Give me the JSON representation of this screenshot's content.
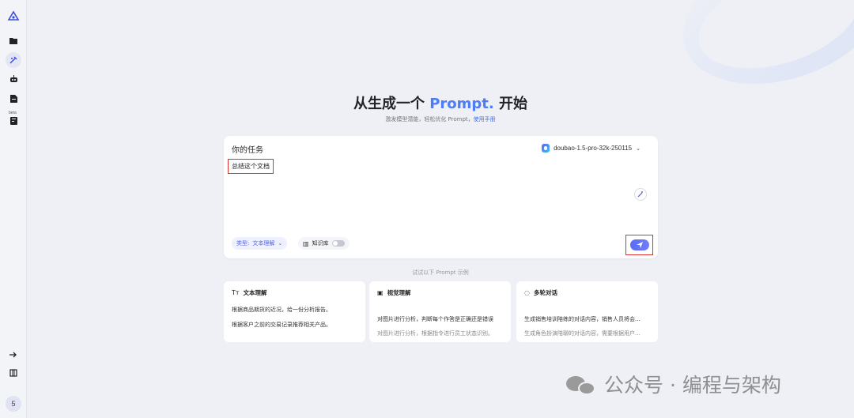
{
  "sidebar": {
    "icons": [
      "logo-icon",
      "folder-icon",
      "prompt-tool-icon",
      "robot-icon",
      "document-icon",
      "beta-feature-icon",
      "arrow-right-icon",
      "library-icon"
    ],
    "beta_label": "beta",
    "avatar_initial": "5"
  },
  "hero": {
    "title_pre": "从生成一个 ",
    "title_accent": "Prompt.",
    "title_post": " 开始",
    "subtitle": "激发模型潜能，轻松优化 Prompt，",
    "subtitle_link": "使用手册"
  },
  "task": {
    "label": "你的任务",
    "model": "doubao-1.5-pro-32k-250115",
    "prompt_text": "总结这个文档",
    "type_prefix": "类型:",
    "type_value": "文本理解",
    "kb_label": "知识库"
  },
  "examples": {
    "hint": "试试以下 Prompt 示例",
    "cards": [
      {
        "icon": "Tт",
        "title": "文本理解",
        "lines": [
          "根据商品期货的近况，给一份分析报告。",
          "根据客户之前的交易记录推荐相关产品。"
        ]
      },
      {
        "icon": "▣",
        "title": "视觉理解",
        "lines": [
          "对图片进行分析，判断每个作答是正确还是错误",
          "对图片进行分析，根据指令进行员工状态识别。"
        ]
      },
      {
        "icon": "◌",
        "title": "多轮对话",
        "lines": [
          "生成销售培训陪练的对话内容，销售人员将会...",
          "生成角色扮演陪聊的对话内容，需要根据用户..."
        ]
      }
    ]
  },
  "watermark": {
    "text": "公众号 · 编程与架构"
  }
}
